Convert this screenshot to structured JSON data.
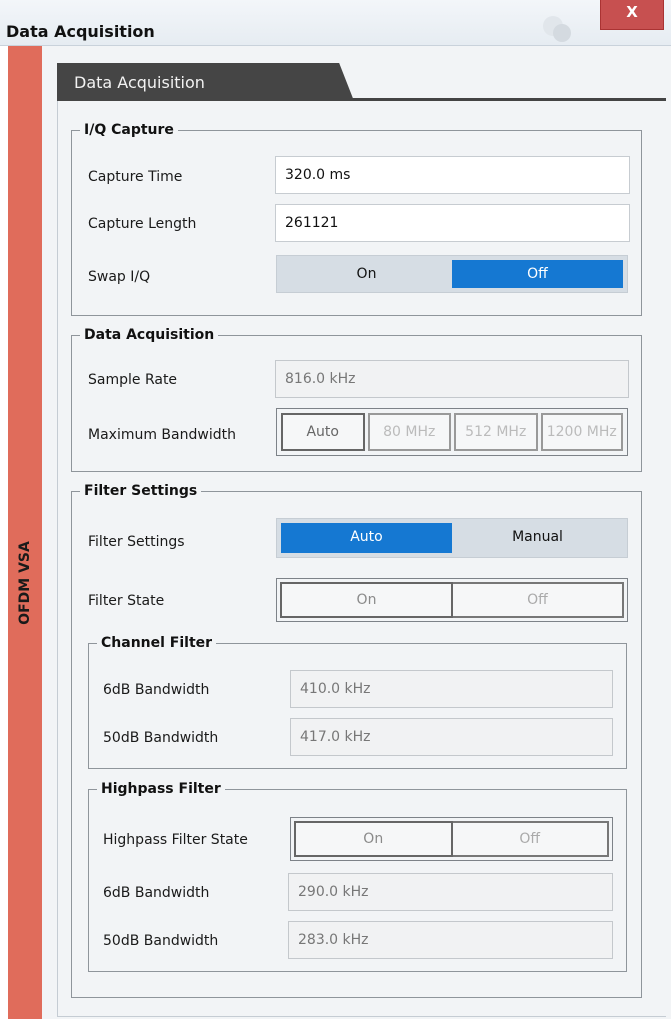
{
  "window": {
    "title": "Data Acquisition",
    "close_glyph": "X"
  },
  "sidebar": {
    "label": "OFDM VSA"
  },
  "tab": {
    "label": "Data Acquisition"
  },
  "iq_capture": {
    "title": "I/Q Capture",
    "capture_time": {
      "label": "Capture Time",
      "value": "320.0 ms"
    },
    "capture_length": {
      "label": "Capture Length",
      "value": "261121"
    },
    "swap_iq": {
      "label": "Swap I/Q",
      "options": [
        "On",
        "Off"
      ],
      "selected": "Off"
    }
  },
  "data_acquisition": {
    "title": "Data Acquisition",
    "sample_rate": {
      "label": "Sample Rate",
      "value": "816.0 kHz"
    },
    "max_bandwidth": {
      "label": "Maximum Bandwidth",
      "options": [
        "Auto",
        "80 MHz",
        "512 MHz",
        "1200 MHz"
      ],
      "selected": "Auto"
    }
  },
  "filter_settings": {
    "title": "Filter Settings",
    "mode": {
      "label": "Filter Settings",
      "options": [
        "Auto",
        "Manual"
      ],
      "selected": "Auto"
    },
    "state": {
      "label": "Filter State",
      "options": [
        "On",
        "Off"
      ]
    },
    "channel_filter": {
      "title": "Channel Filter",
      "bw6": {
        "label": "6dB Bandwidth",
        "value": "410.0 kHz"
      },
      "bw50": {
        "label": "50dB Bandwidth",
        "value": "417.0 kHz"
      }
    },
    "highpass_filter": {
      "title": "Highpass Filter",
      "state": {
        "label": "Highpass Filter State",
        "options": [
          "On",
          "Off"
        ]
      },
      "bw6": {
        "label": "6dB Bandwidth",
        "value": "290.0 kHz"
      },
      "bw50": {
        "label": "50dB Bandwidth",
        "value": "283.0 kHz"
      }
    }
  },
  "colors": {
    "accent": "#1578d2",
    "sidebar": "#e06c5b",
    "close": "#c75050",
    "tab": "#454545"
  }
}
